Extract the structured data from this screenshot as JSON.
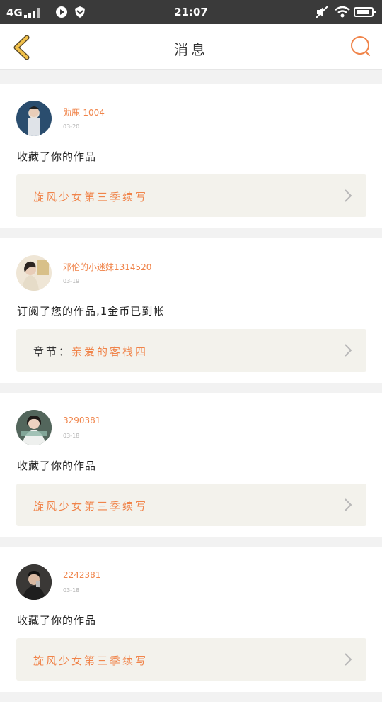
{
  "status_bar": {
    "network": "4G",
    "time": "21:07"
  },
  "header": {
    "title": "消息"
  },
  "colors": {
    "accent": "#f0844a",
    "back": "#f2c14a",
    "card_bg": "#f3f2ec"
  },
  "messages": [
    {
      "user": "勋鹿-1004",
      "date": "03-20",
      "action": "收藏了你的作品",
      "work_prefix": "",
      "work": "旋风少女第三季续写"
    },
    {
      "user": "邓伦的小迷妹1314520",
      "date": "03-19",
      "action": "订阅了您的作品,1金币已到帐",
      "work_prefix": "章节：",
      "work": "亲爱的客栈四"
    },
    {
      "user": "3290381",
      "date": "03-18",
      "action": "收藏了你的作品",
      "work_prefix": "",
      "work": "旋风少女第三季续写"
    },
    {
      "user": "2242381",
      "date": "03-18",
      "action": "收藏了你的作品",
      "work_prefix": "",
      "work": "旋风少女第三季续写"
    }
  ]
}
